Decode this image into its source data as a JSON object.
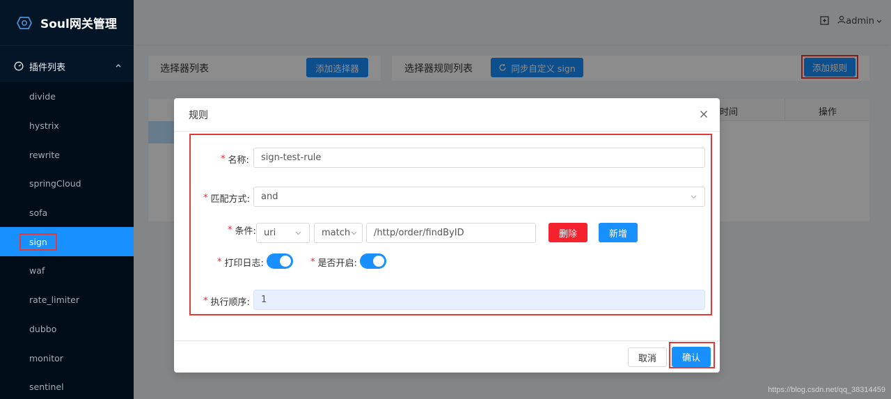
{
  "app": {
    "title": "Soul网关管理"
  },
  "header": {
    "user": "admin"
  },
  "sidebar": {
    "group_label": "插件列表",
    "items": [
      {
        "label": "divide"
      },
      {
        "label": "hystrix"
      },
      {
        "label": "rewrite"
      },
      {
        "label": "springCloud"
      },
      {
        "label": "sofa"
      },
      {
        "label": "sign"
      },
      {
        "label": "waf"
      },
      {
        "label": "rate_limiter"
      },
      {
        "label": "dubbo"
      },
      {
        "label": "monitor"
      },
      {
        "label": "sentinel"
      }
    ]
  },
  "background": {
    "selector_title": "选择器列表",
    "add_selector": "添加选择器",
    "rule_title": "选择器规则列表",
    "sync_label": "同步自定义 sign",
    "add_rule": "添加规则",
    "col_time": "时间",
    "col_ops": "操作"
  },
  "modal": {
    "title": "规则",
    "name_label": "名称:",
    "name_value": "sign-test-rule",
    "match_label": "匹配方式:",
    "match_value": "and",
    "cond_label": "条件:",
    "cond_param": "uri",
    "cond_op": "match",
    "cond_value": "/http/order/findByID",
    "delete_btn": "删除",
    "add_btn": "新增",
    "log_label": "打印日志:",
    "enable_label": "是否开启:",
    "order_label": "执行顺序:",
    "order_value": "1",
    "cancel": "取消",
    "confirm": "确认"
  },
  "watermark": "https://blog.csdn.net/qq_38314459"
}
